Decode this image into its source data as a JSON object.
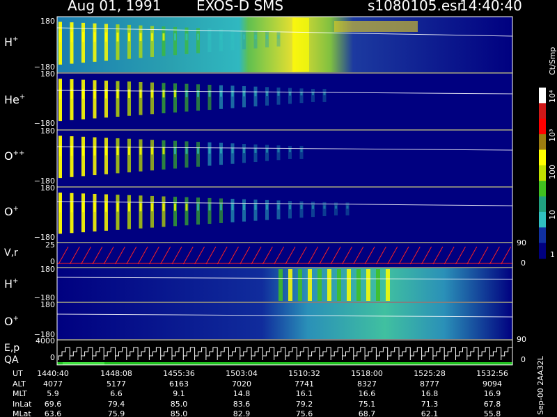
{
  "header": {
    "date": "Aug 01, 1991",
    "instrument": "EXOS-D SMS",
    "file": "s1080105.esr",
    "time": "14:40:40"
  },
  "colorbar": {
    "unit_label": "Ct/Smp",
    "ticks": [
      "10⁴",
      "10³",
      "100",
      "10",
      "1"
    ],
    "colors": [
      "#ffffff",
      "#d01818",
      "#ff0000",
      "#9c7c10",
      "#ffff00",
      "#c0e000",
      "#40c020",
      "#20a080",
      "#30c0c0",
      "#1030a0",
      "#000080"
    ]
  },
  "panels": [
    {
      "label": "H",
      "sup": "+",
      "ymax": "180",
      "ymin": "−180"
    },
    {
      "label": "He",
      "sup": "+",
      "ymax": "180",
      "ymin": "−180"
    },
    {
      "label": "O",
      "sup": "++",
      "ymax": "180",
      "ymin": "−180"
    },
    {
      "label": "O",
      "sup": "+",
      "ymax": "180",
      "ymin": "−180"
    },
    {
      "label": "V,r",
      "sup": "",
      "ymax": "25",
      "ymin": "0",
      "right_top": "90",
      "right_bottom": "0"
    },
    {
      "label": "H",
      "sup": "+",
      "ymax": "180",
      "ymin": "−180"
    },
    {
      "label": "O",
      "sup": "+",
      "ymax": "180",
      "ymin": "−180",
      "right_bottom": "90"
    },
    {
      "label": "E,p",
      "sup": "",
      "ymax": "4000",
      "ymin": "0",
      "right_bottom": "0"
    }
  ],
  "qa_label": "QA",
  "side_label": "Sep-00 2AA32L",
  "ephemeris": {
    "row_labels": [
      "UT",
      "ALT",
      "MLT",
      "InLat",
      "MLat"
    ],
    "columns": [
      [
        "1440:40",
        "4077",
        "5.9",
        "69.6",
        "63.6"
      ],
      [
        "1448:08",
        "5177",
        "6.6",
        "79.4",
        "75.9"
      ],
      [
        "1455:36",
        "6163",
        "9.1",
        "85.0",
        "85.0"
      ],
      [
        "1503:04",
        "7020",
        "14.8",
        "83.6",
        "82.9"
      ],
      [
        "1510:32",
        "7741",
        "16.1",
        "79.2",
        "75.6"
      ],
      [
        "1518:00",
        "8327",
        "16.6",
        "75.1",
        "68.7"
      ],
      [
        "1525:28",
        "8777",
        "16.8",
        "71.3",
        "62.1"
      ],
      [
        "1532:56",
        "9094",
        "16.9",
        "67.8",
        "55.8"
      ]
    ]
  },
  "chart_data": {
    "type": "heatmap",
    "title": "Aug 01, 1991   EXOS-D SMS",
    "xlabel": "UT",
    "x_ticks": [
      "1440:40",
      "1448:08",
      "1455:36",
      "1503:04",
      "1510:32",
      "1518:00",
      "1525:28",
      "1532:56"
    ],
    "color_scale": "log",
    "color_range": [
      1,
      10000
    ],
    "series": [
      {
        "name": "H+",
        "ylim": [
          -180,
          180
        ]
      },
      {
        "name": "He+",
        "ylim": [
          -180,
          180
        ]
      },
      {
        "name": "O++",
        "ylim": [
          -180,
          180
        ]
      },
      {
        "name": "O+",
        "ylim": [
          -180,
          180
        ]
      },
      {
        "name": "V,r",
        "ylim": [
          0,
          25
        ]
      },
      {
        "name": "H+",
        "ylim": [
          -180,
          180
        ]
      },
      {
        "name": "O+",
        "ylim": [
          -180,
          180
        ]
      },
      {
        "name": "E,p",
        "ylim": [
          0,
          4000
        ]
      }
    ]
  }
}
